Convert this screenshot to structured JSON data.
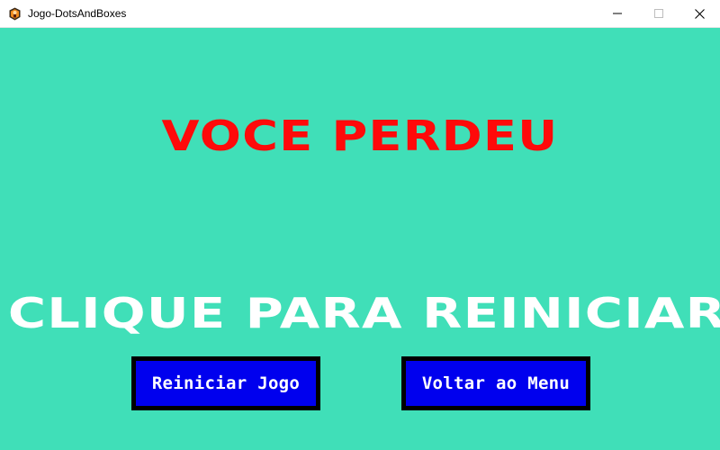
{
  "window": {
    "title": "Jogo-DotsAndBoxes",
    "icon": "game-app-icon",
    "controls": {
      "minimize_icon": "minimize-icon",
      "maximize_icon": "maximize-icon",
      "close_icon": "close-icon"
    }
  },
  "screen": {
    "background_color": "#40dfb8",
    "result_text": "VOCE PERDEU",
    "result_color": "#ff0a0a",
    "hint_text": "CLIQUE PARA REINICIAR",
    "hint_color": "#ffffff"
  },
  "buttons": {
    "restart_label": "Reiniciar Jogo",
    "menu_label": "Voltar ao Menu",
    "button_color": "#0000ee",
    "button_border_color": "#000000"
  }
}
